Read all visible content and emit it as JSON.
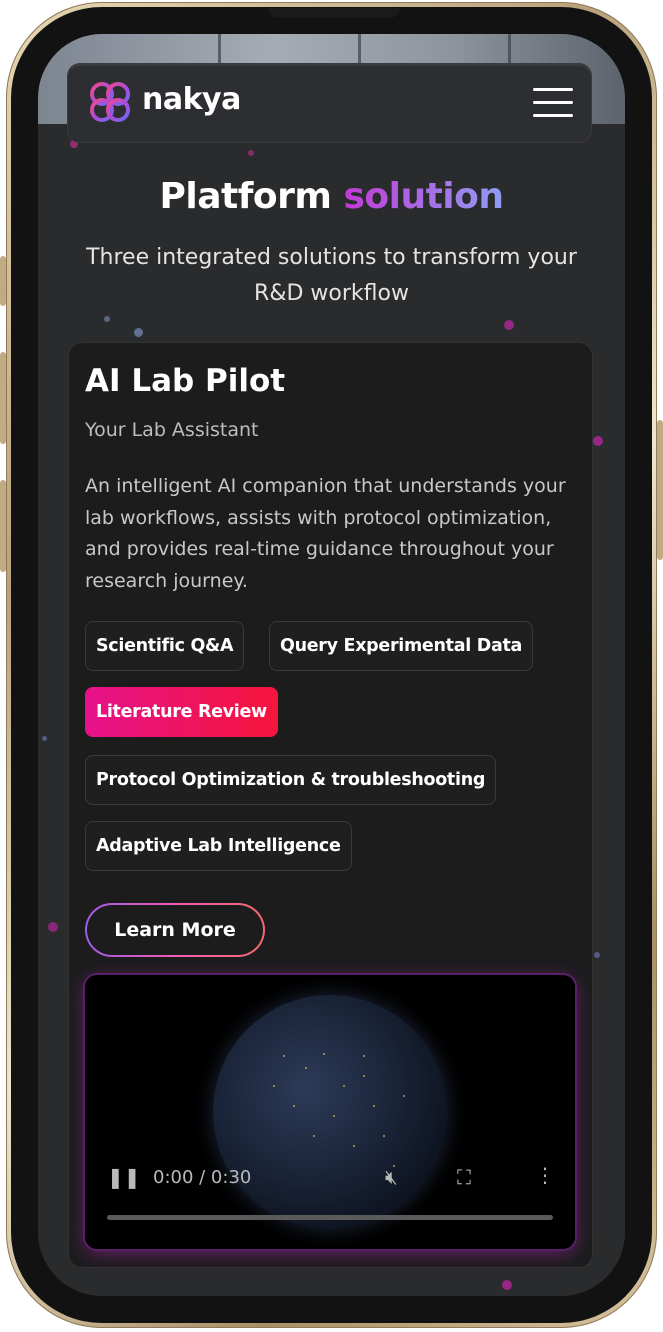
{
  "brand": {
    "name": "nakya"
  },
  "section": {
    "title_main": "Platform",
    "title_accent": "solution",
    "subtitle": "Three integrated solutions to transform your R&D workflow"
  },
  "card": {
    "title": "AI Lab Pilot",
    "tagline": "Your Lab Assistant",
    "description": "An intelligent AI companion that understands your lab workflows, assists with protocol optimization, and provides real-time guidance throughout your research journey.",
    "chips": [
      {
        "label": "Scientific Q&A",
        "active": false
      },
      {
        "label": "Query Experimental Data",
        "active": false
      },
      {
        "label": "Literature Review",
        "active": true
      },
      {
        "label": "Protocol Optimization & troubleshooting",
        "active": false
      },
      {
        "label": "Adaptive Lab Intelligence",
        "active": false
      }
    ],
    "cta": "Learn More"
  },
  "video": {
    "time": "0:00 / 0:30",
    "icons": [
      "pause-icon",
      "mute-icon",
      "fullscreen-icon",
      "more-icon"
    ],
    "progress": 0
  },
  "colors": {
    "accent_chip": "#e5128a",
    "accent_title": "#c33ad6",
    "screen_bg": "#2a2b2d",
    "card_bg": "#1c1c1d"
  }
}
